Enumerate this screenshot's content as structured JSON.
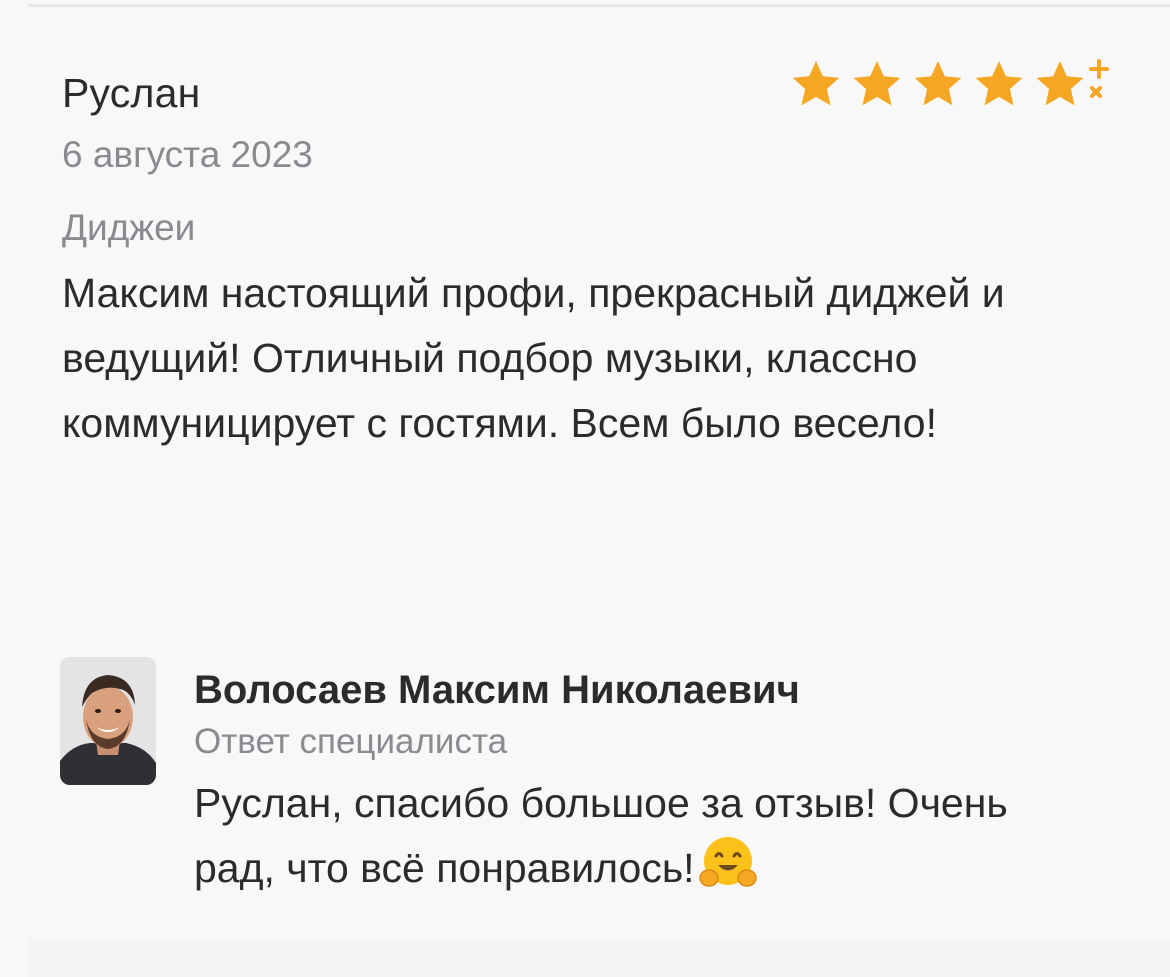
{
  "review": {
    "author": "Руслан",
    "date": "6 августа 2023",
    "category": "Диджеи",
    "text": "Максим настоящий профи, прекрасный диджей и ведущий! Отличный подбор музыки, классно коммуницирует с гостями. Всем было весело!",
    "rating": 5,
    "rating_max": 5,
    "star_color": "#f5a623"
  },
  "reply": {
    "name": "Волосаев Максим Николаевич",
    "role": "Ответ специалиста",
    "text": "Руслан, спасибо большое за отзыв! Очень рад, что всё понравилось!",
    "emoji_icon": "hugging-face-icon"
  }
}
